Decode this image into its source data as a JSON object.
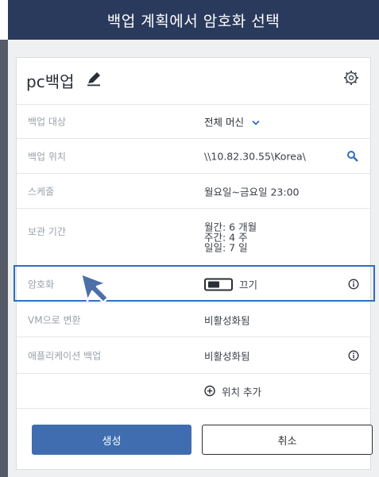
{
  "banner": {
    "title": "백업 계획에서 암호화 선택"
  },
  "header": {
    "plan_name": "pc백업"
  },
  "rows": {
    "backup_target": {
      "label": "백업 대상",
      "value": "전체 머신"
    },
    "backup_location": {
      "label": "백업 위치",
      "value": "\\\\10.82.30.55\\Korea\\"
    },
    "schedule": {
      "label": "스케줄",
      "value": "월요일~금요일 23:00"
    },
    "retention": {
      "label": "보관 기간",
      "monthly": "월간: 6 개월",
      "weekly": "주간: 4 주",
      "daily": "일일: 7 일"
    },
    "encryption": {
      "label": "암호화",
      "toggle_text": "끄기"
    },
    "vm_convert": {
      "label": "VM으로 변환",
      "value": "비활성화됨"
    },
    "app_backup": {
      "label": "애플리케이션 백업",
      "value": "비활성화됨"
    },
    "add_location": {
      "label": "위치 추가"
    }
  },
  "buttons": {
    "create": "생성",
    "cancel": "취소"
  },
  "colors": {
    "banner_bg": "#2a3a5c",
    "primary": "#3f6db0",
    "highlight": "#2f6fbd"
  }
}
